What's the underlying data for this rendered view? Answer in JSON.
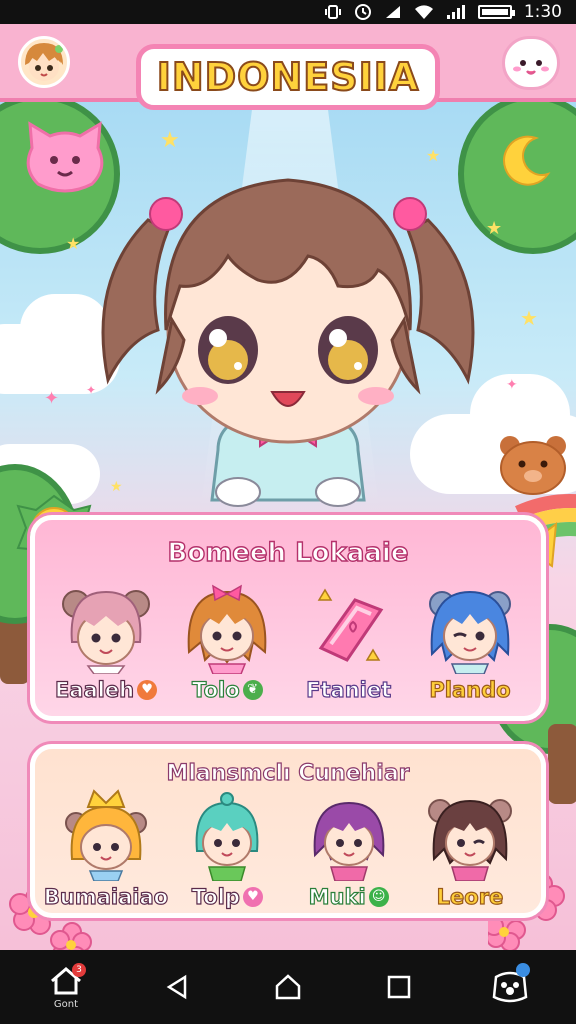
{
  "status_bar": {
    "time": "1:30"
  },
  "header": {
    "title": "INDONESIIA",
    "avatar_icon": "player-avatar",
    "mascot_icon": "cloud-mascot-icon"
  },
  "panel_featured": {
    "title": "Bomeeh Lokaaie",
    "items": [
      {
        "label": "Eaaleh",
        "icon": "heart-icon",
        "badge_color": "#f07a3c"
      },
      {
        "label": "Tolo",
        "icon": "leaf-icon",
        "badge_color": "#4cae4c"
      },
      {
        "label": "Ftaniet",
        "icon": "",
        "badge_color": ""
      },
      {
        "label": "Plando",
        "icon": "",
        "badge_color": ""
      }
    ]
  },
  "panel_roster": {
    "title": "Mlansmclı Cunehiar",
    "items": [
      {
        "label": "Bumaiaiao",
        "icon": ""
      },
      {
        "label": "Tolp",
        "icon": "heart-icon",
        "badge_color": "#f070b0"
      },
      {
        "label": "Muki",
        "icon": "smile-icon",
        "badge_color": "#3cb24a"
      },
      {
        "label": "Leore",
        "icon": ""
      }
    ]
  },
  "navbar": {
    "home_label": "Gont",
    "home_badge": "3"
  },
  "colors": {
    "accent": "#f484b4",
    "title_fill": "#ffd23c",
    "panel_border": "#f08ab9"
  }
}
